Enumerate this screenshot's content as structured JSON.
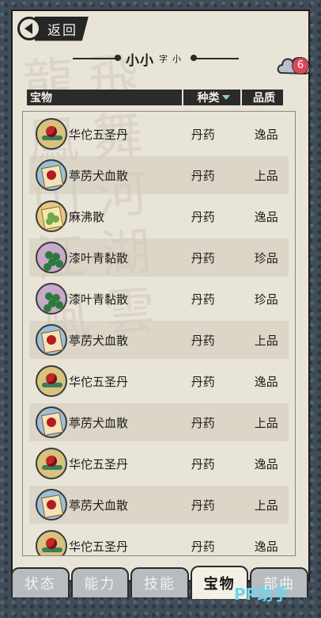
{
  "header": {
    "back_label": "返回",
    "title_main": "小小",
    "title_sub": "字小",
    "badge_count": "6"
  },
  "table": {
    "columns": {
      "name": "宝物",
      "kind": "种类",
      "grade": "品质"
    },
    "rows": [
      {
        "icon": "red-pill-icon",
        "name": "华佗五圣丹",
        "kind": "丹药",
        "grade": "逸品"
      },
      {
        "icon": "red-scroll-icon",
        "name": "葶苈犬血散",
        "kind": "丹药",
        "grade": "上品"
      },
      {
        "icon": "green-scroll-icon",
        "name": "麻沸散",
        "kind": "丹药",
        "grade": "逸品"
      },
      {
        "icon": "green-beads-icon",
        "name": "漆叶青黏散",
        "kind": "丹药",
        "grade": "珍品"
      },
      {
        "icon": "green-beads-icon",
        "name": "漆叶青黏散",
        "kind": "丹药",
        "grade": "珍品"
      },
      {
        "icon": "red-scroll-icon",
        "name": "葶苈犬血散",
        "kind": "丹药",
        "grade": "上品"
      },
      {
        "icon": "red-pill-icon",
        "name": "华佗五圣丹",
        "kind": "丹药",
        "grade": "逸品"
      },
      {
        "icon": "red-scroll-icon",
        "name": "葶苈犬血散",
        "kind": "丹药",
        "grade": "上品"
      },
      {
        "icon": "red-pill-icon",
        "name": "华佗五圣丹",
        "kind": "丹药",
        "grade": "逸品"
      },
      {
        "icon": "red-scroll-icon",
        "name": "葶苈犬血散",
        "kind": "丹药",
        "grade": "上品"
      },
      {
        "icon": "red-pill-icon",
        "name": "华佗五圣丹",
        "kind": "丹药",
        "grade": "逸品"
      }
    ]
  },
  "tabs": [
    "状态",
    "能力",
    "技能",
    "宝物",
    "部曲"
  ],
  "active_tab": "宝物",
  "watermark": "PP助手",
  "colors": {
    "paper": "#e9e4d8",
    "header_bar": "#2b2b2b",
    "badge": "#d6495a",
    "frame": "#404c57"
  }
}
